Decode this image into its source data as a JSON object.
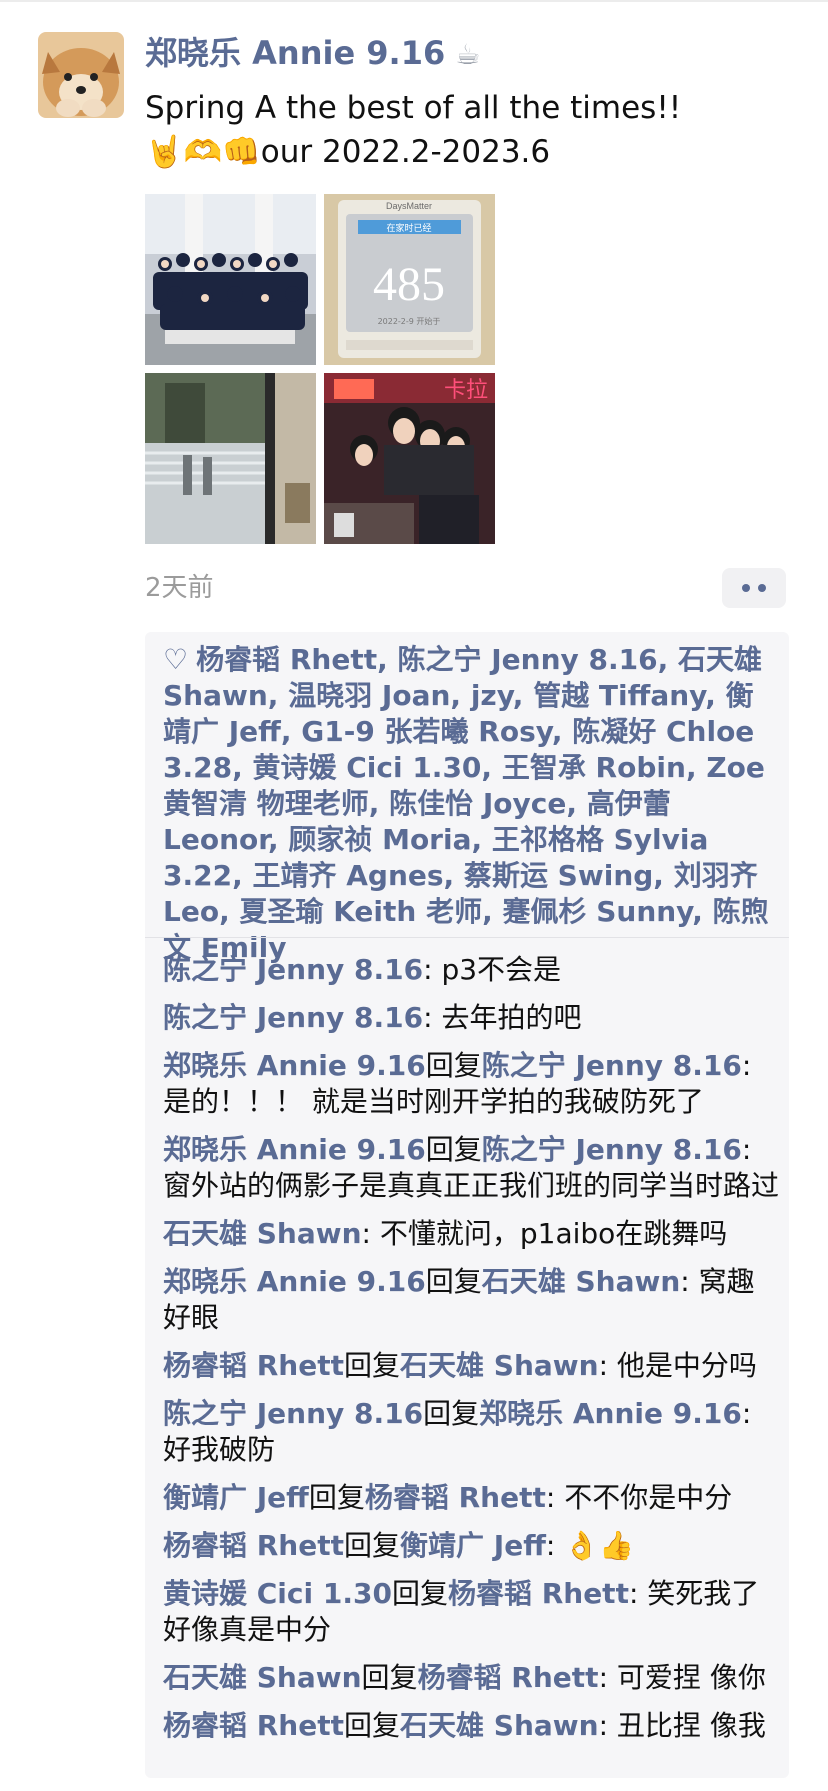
{
  "post": {
    "author": "郑晓乐 Annie 9.16",
    "author_icon": "coffee-cup-icon",
    "text_line1": "Spring A the best of all the times!!",
    "emoji": "🤘🫶👊",
    "text_line2": "our 2022.2-2023.6",
    "timestamp": "2天前",
    "photos": [
      "group-photo",
      "daysmatter-485-counter",
      "window-shadows",
      "friends-selfie"
    ],
    "photo2_header": "DaysMatter",
    "photo2_title": "在家时已经",
    "photo2_number": "485",
    "photo2_date": "2022-2-9 开始于",
    "photo4_sign": "卡拉"
  },
  "likes": {
    "heart_icon": "♡",
    "names": [
      "杨睿韬 Rhett",
      "陈之宁 Jenny 8.16",
      "石天雄 Shawn",
      "温晓羽 Joan",
      "jzy",
      "管越 Tiffany",
      "衡靖广 Jeff",
      "G1-9 张若曦 Rosy",
      "陈凝好 Chloe 3.28",
      "黄诗媛 Cici 1.30",
      "王智承 Robin",
      "Zoe 黄智清 物理老师",
      "陈佳怡 Joyce",
      "高伊蕾 Leonor",
      "顾家祯 Moria",
      "王祁格格 Sylvia 3.22",
      "王靖齐 Agnes",
      "蔡斯运 Swing",
      "刘羽齐 Leo",
      "夏圣瑜 Keith 老师",
      "蹇佩杉 Sunny",
      "陈煦文 Emily"
    ]
  },
  "reply_word": "回复",
  "comments": [
    {
      "from": "陈之宁 Jenny 8.16",
      "to": "",
      "text": "p3不会是"
    },
    {
      "from": "陈之宁 Jenny 8.16",
      "to": "",
      "text": "去年拍的吧"
    },
    {
      "from": "郑晓乐 Annie 9.16",
      "to": "陈之宁 Jenny 8.16",
      "text": "是的！！！ 就是当时刚开学拍的我破防死了"
    },
    {
      "from": "郑晓乐 Annie 9.16",
      "to": "陈之宁 Jenny 8.16",
      "text": "窗外站的俩影子是真真正正我们班的同学当时路过"
    },
    {
      "from": "石天雄 Shawn",
      "to": "",
      "text": "不懂就问，p1aibo在跳舞吗"
    },
    {
      "from": "郑晓乐 Annie 9.16",
      "to": "石天雄 Shawn",
      "text": "窝趣好眼"
    },
    {
      "from": "杨睿韬 Rhett",
      "to": "石天雄 Shawn",
      "text": "他是中分吗"
    },
    {
      "from": "陈之宁 Jenny 8.16",
      "to": "郑晓乐 Annie 9.16",
      "text": "好我破防"
    },
    {
      "from": "衡靖广 Jeff",
      "to": "杨睿韬 Rhett",
      "text": "不不你是中分"
    },
    {
      "from": "杨睿韬 Rhett",
      "to": "衡靖广 Jeff",
      "text": "👌👍"
    },
    {
      "from": "黄诗媛 Cici 1.30",
      "to": "杨睿韬 Rhett",
      "text": "笑死我了好像真是中分"
    },
    {
      "from": "石天雄 Shawn",
      "to": "杨睿韬 Rhett",
      "text": "可爱捏 像你"
    },
    {
      "from": "杨睿韬 Rhett",
      "to": "石天雄 Shawn",
      "text": "丑比捏 像我"
    }
  ],
  "colors": {
    "name_blue": "#5a6b94",
    "panel_bg": "#f6f6f8",
    "timestamp_gray": "#9b9b9b"
  }
}
